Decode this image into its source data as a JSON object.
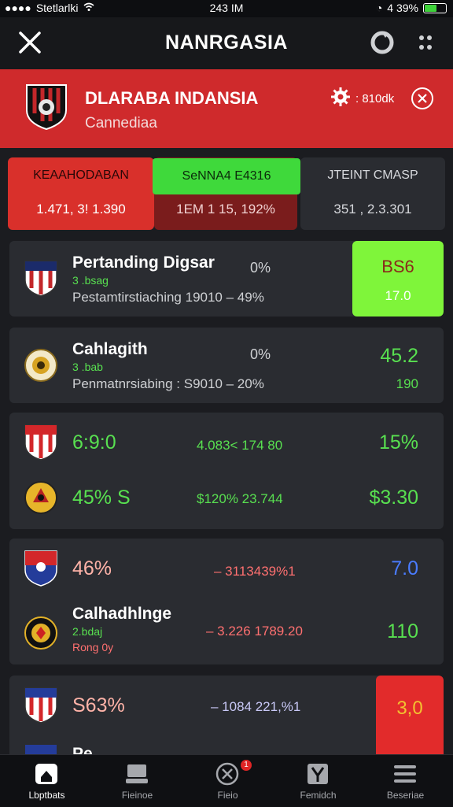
{
  "status_bar": {
    "carrier": "Stetlarlki",
    "time": "243 IM",
    "battery": "4 39%"
  },
  "top_bar": {
    "title": "NANRGASIA"
  },
  "league": {
    "name": "DLARABA INDANSIA",
    "subtitle": "Cannediaa",
    "settings_value": ": 810dk"
  },
  "summary": [
    {
      "label": "KEAAHODABAN",
      "value": "1.471, 3! 1.390"
    },
    {
      "label": "SeNNA4 E4316",
      "value": "1EM 1 15, 192%"
    },
    {
      "label": "JTEINT CMASP",
      "value": "351 , 2.3.301"
    }
  ],
  "matches": [
    {
      "team": "Pertanding Digsar",
      "sub": "3 .bsag",
      "detail": "Pestamtirstiaching 19010 – 49%",
      "pct": "0%",
      "odds_top": "BS6",
      "odds_bottom": "17.0"
    },
    {
      "team": "Cahlagith",
      "sub": "3 .bab",
      "detail": "Penmatnrsiabing : S9010 – 20%",
      "pct": "0%",
      "odds_top": "45.2",
      "odds_bottom": "190"
    },
    {
      "row1": {
        "left": "6:9:0",
        "mid": "4.083< 174 80",
        "right": "15%"
      },
      "row2": {
        "left": "45% S",
        "mid": "$120% 23.744",
        "right": "$3.30"
      }
    },
    {
      "row1": {
        "left": "46%",
        "mid": "– 3113439%1",
        "right": "7.0"
      },
      "team": "Calhadhlnge",
      "sub": "2.bdaj",
      "sub2": "Rong 0y",
      "mid2": "– 3.226 1789.20",
      "right2": "110"
    },
    {
      "left": "S63%",
      "mid": "– 1084 221,%1",
      "right": "3,0",
      "team_partial": "Pe..."
    }
  ],
  "tabs": [
    {
      "label": "Lbptbats",
      "icon": "home-icon",
      "active": true
    },
    {
      "label": "Fieinoe",
      "icon": "scores-icon"
    },
    {
      "label": "Fieio",
      "icon": "x-circle-icon",
      "badge": "1"
    },
    {
      "label": "Femidch",
      "icon": "trophy-icon"
    },
    {
      "label": "Beseriae",
      "icon": "menu-icon"
    }
  ],
  "colors": {
    "brand_red": "#cf2a2c",
    "accent_green": "#3fd93b",
    "background": "#1b1c20"
  }
}
